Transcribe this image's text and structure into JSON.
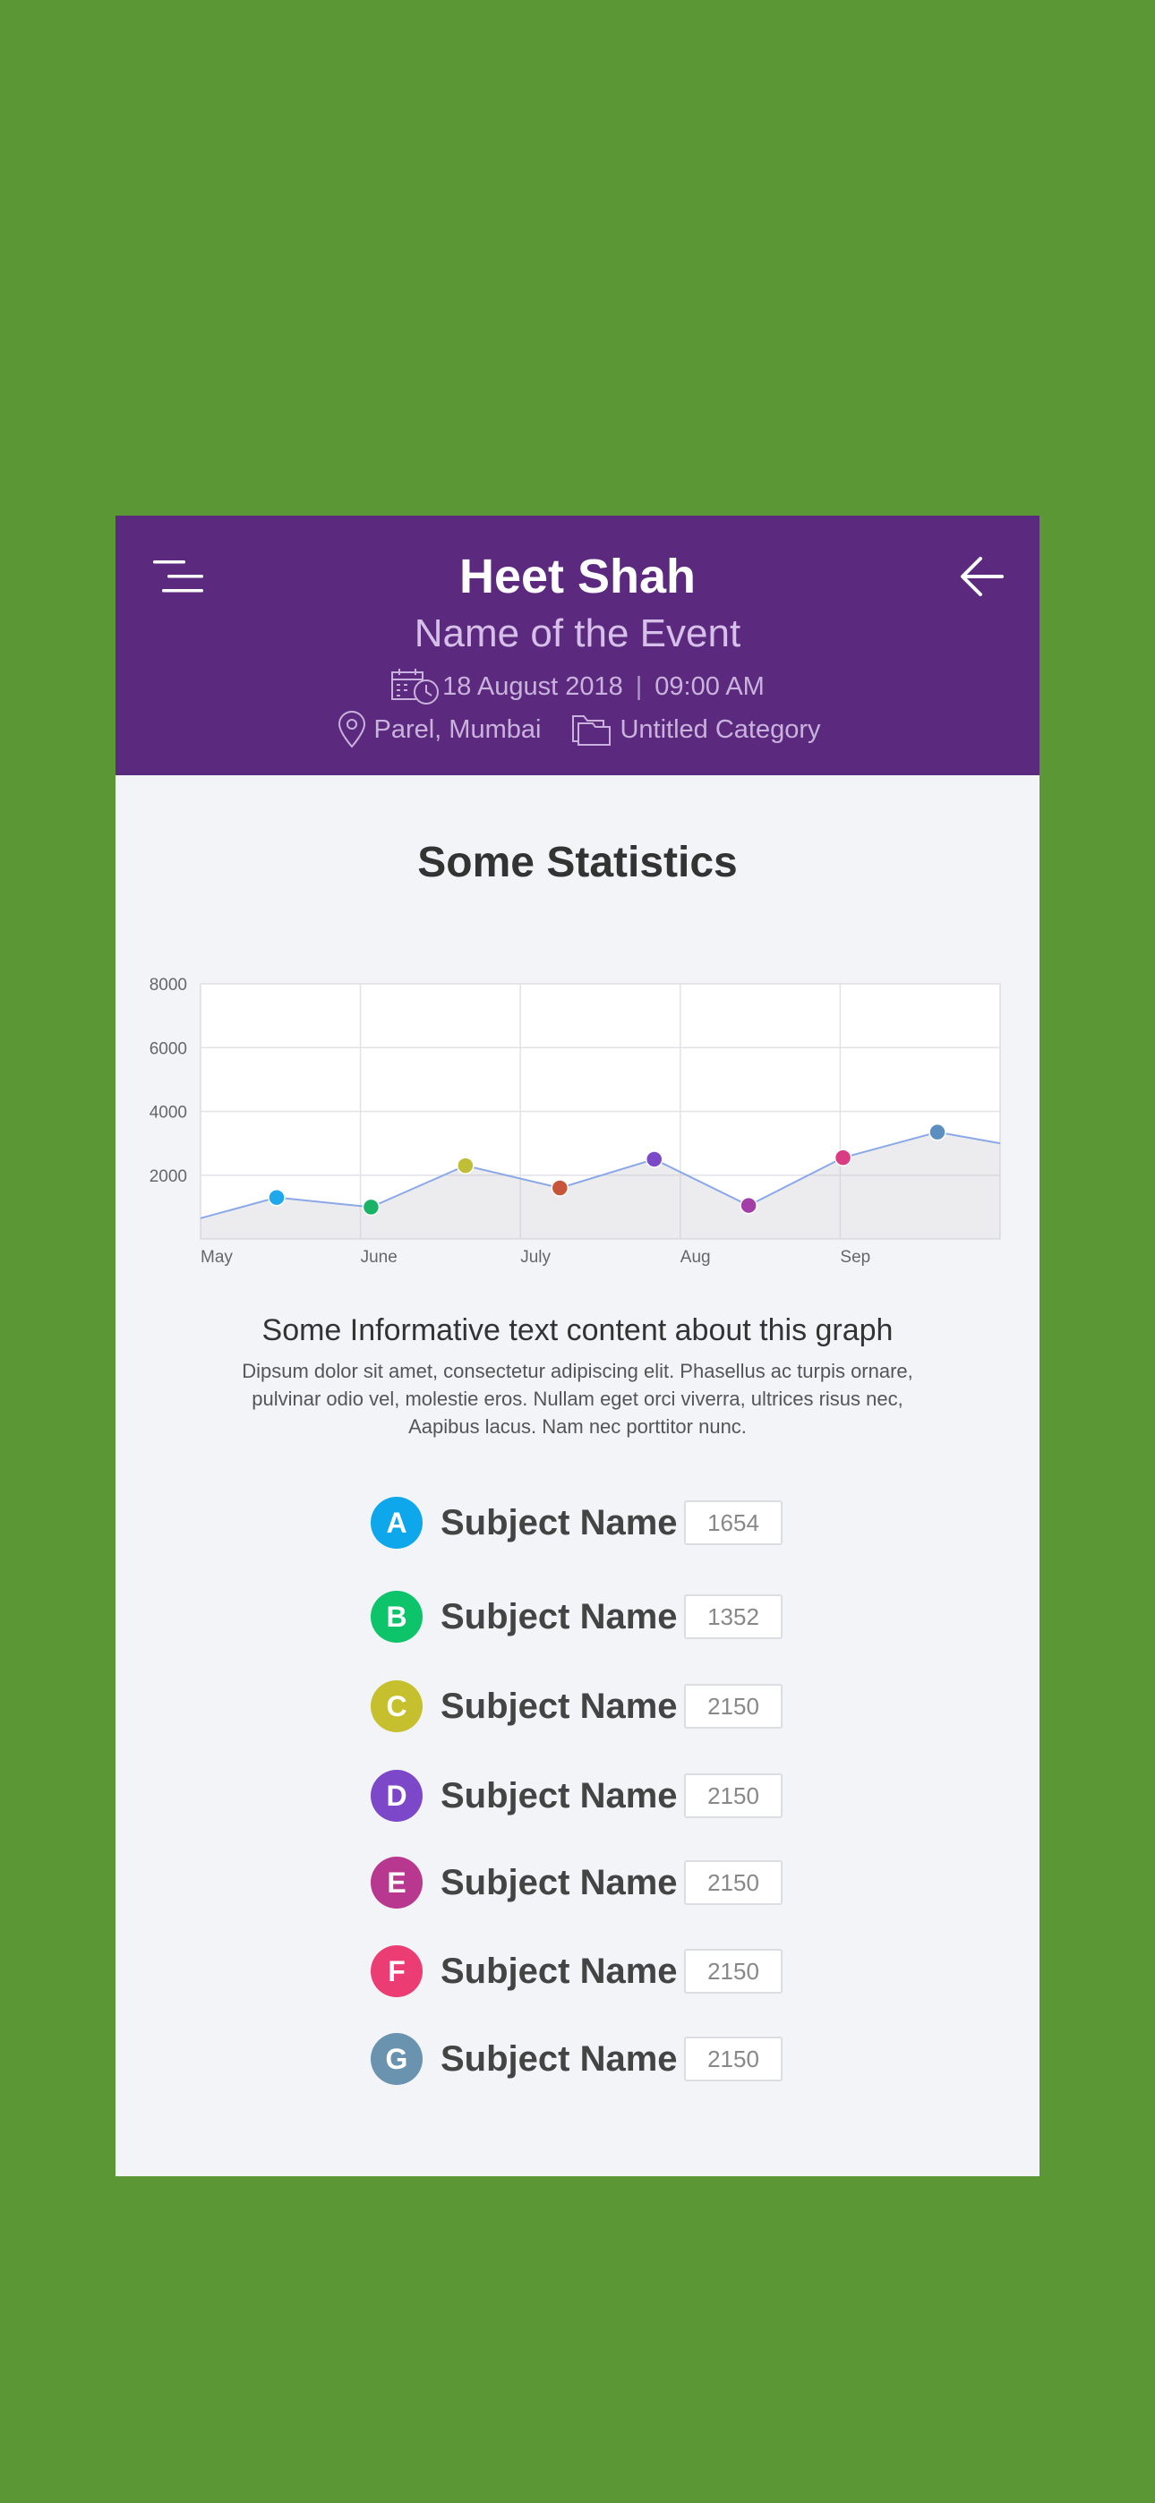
{
  "header": {
    "title": "Heet Shah",
    "subtitle": "Name of the Event",
    "date": "18 August 2018",
    "time": "09:00 AM",
    "separator": "|",
    "location": "Parel, Mumbai",
    "category": "Untitled Category",
    "background_color": "#5b2a7e"
  },
  "icons": {
    "menu": "menu-icon",
    "back": "arrow-left-icon",
    "calendar": "calendar-clock-icon",
    "location": "map-pin-icon",
    "category": "folder-icon"
  },
  "stats": {
    "title": "Some Statistics"
  },
  "chart_data": {
    "type": "area",
    "title": "",
    "x_tick_labels": [
      "May",
      "June",
      "July",
      "Aug",
      "Sep"
    ],
    "y_tick_labels": [
      "8000",
      "6000",
      "4000",
      "2000"
    ],
    "ylim": [
      0,
      8000
    ],
    "grid": true,
    "series": [
      {
        "values": [
          650,
          1300,
          1000,
          2300,
          1600,
          2500,
          1050,
          2550,
          3350,
          3000
        ],
        "marker_colors": [
          "",
          "#1fa8ec",
          "#19b366",
          "#bfbe37",
          "#c7553a",
          "#7b4ac9",
          "#a33ea6",
          "#d93c82",
          "#5c8fbf",
          ""
        ]
      }
    ]
  },
  "info": {
    "title": "Some Informative text content about this graph",
    "body": "Dipsum dolor sit amet, consectetur adipiscing elit. Phasellus ac turpis ornare, pulvinar odio vel, molestie eros. Nullam eget orci viverra, ultrices risus nec, Aapibus lacus. Nam nec porttitor nunc."
  },
  "subjects": [
    {
      "letter": "A",
      "name": "Subject Name",
      "value": "1654",
      "color": "#0fa7ec"
    },
    {
      "letter": "B",
      "name": "Subject Name",
      "value": "1352",
      "color": "#0ec46a"
    },
    {
      "letter": "C",
      "name": "Subject Name",
      "value": "2150",
      "color": "#c6c02e"
    },
    {
      "letter": "D",
      "name": "Subject Name",
      "value": "2150",
      "color": "#7c47c8"
    },
    {
      "letter": "E",
      "name": "Subject Name",
      "value": "2150",
      "color": "#b8388f"
    },
    {
      "letter": "F",
      "name": "Subject Name",
      "value": "2150",
      "color": "#ec3c74"
    },
    {
      "letter": "G",
      "name": "Subject Name",
      "value": "2150",
      "color": "#6a93b0"
    }
  ]
}
